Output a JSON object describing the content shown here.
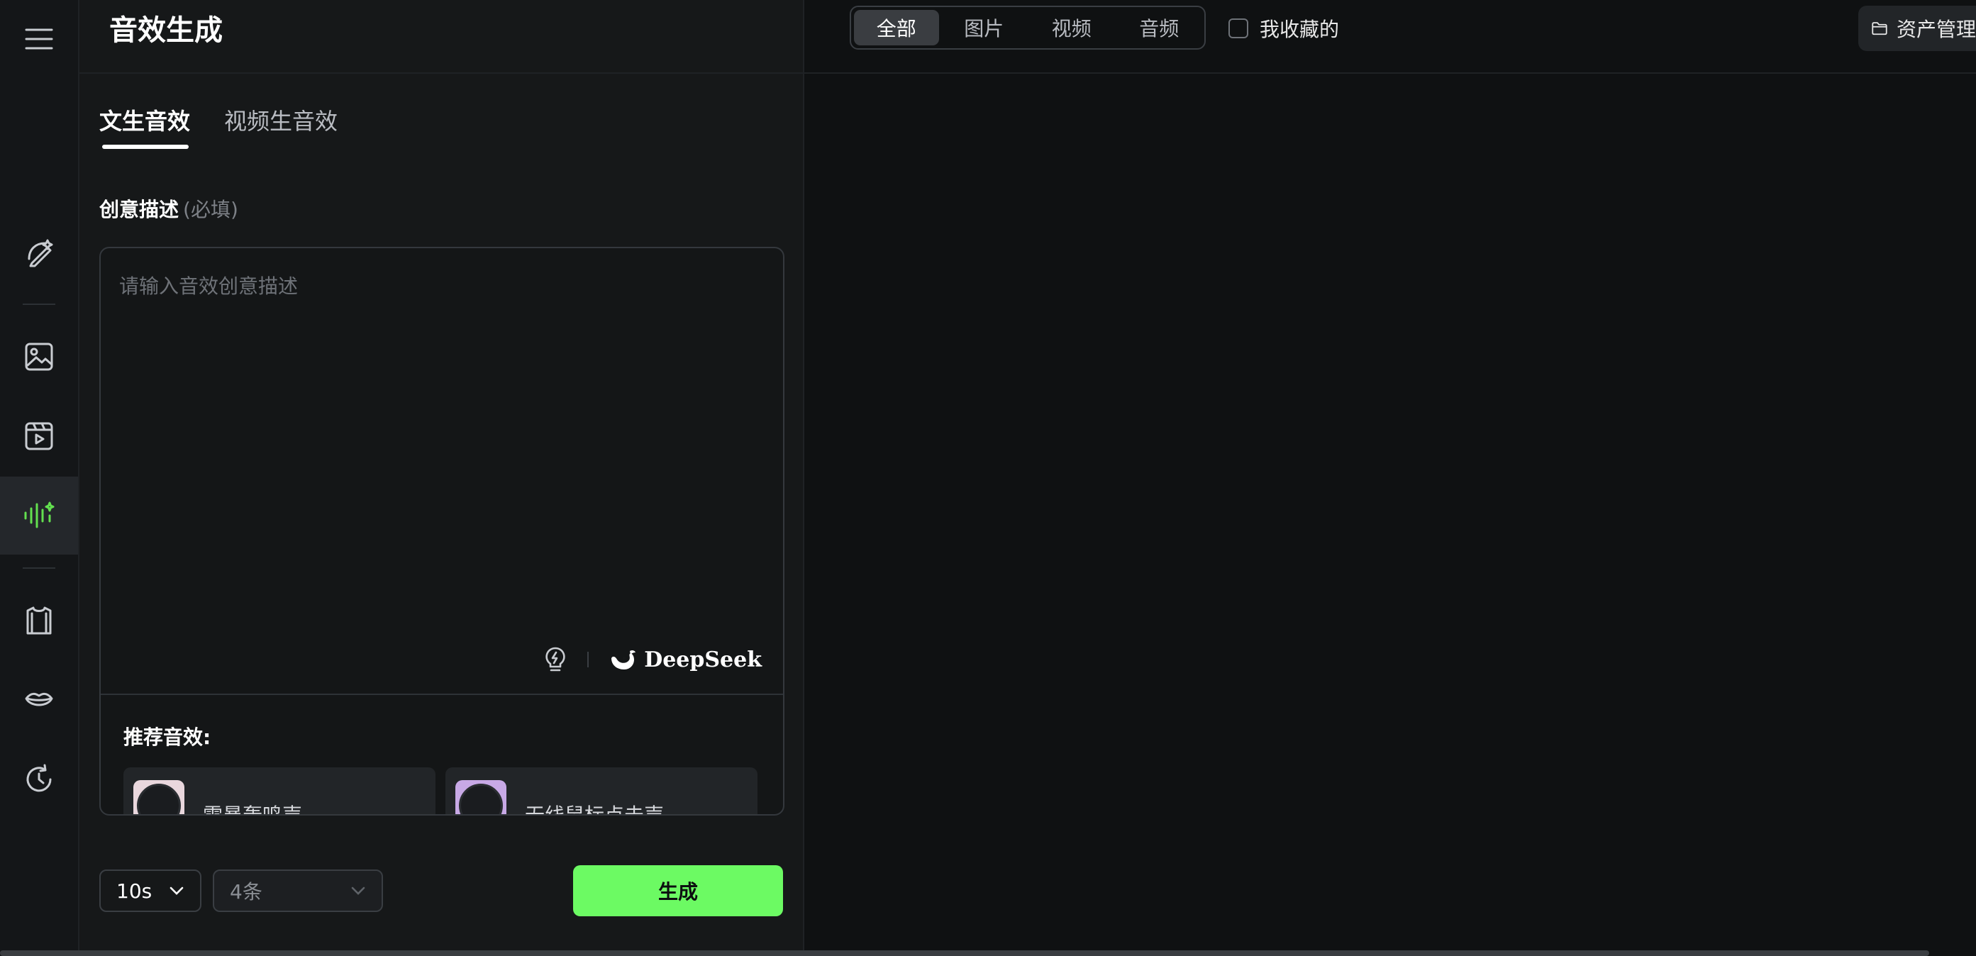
{
  "page_title": "音效生成",
  "tabs": [
    {
      "label": "文生音效",
      "active": true
    },
    {
      "label": "视频生音效",
      "active": false
    }
  ],
  "prompt": {
    "label": "创意描述",
    "required_hint": "(必填)",
    "placeholder": "请输入音效创意描述",
    "value": ""
  },
  "tools": {
    "inspire_icon": "lightbulb-bolt-icon",
    "brand_name": "DeepSeek",
    "brand_icon": "whale-icon"
  },
  "recommended": {
    "label": "推荐音效:",
    "items": [
      {
        "name": "雷暴轰鸣声",
        "thumb_color": "#e9d7dd"
      },
      {
        "name": "无线鼠标点击声",
        "thumb_color": "#c8a9e6"
      }
    ]
  },
  "controls": {
    "duration": "10s",
    "count": "4条",
    "generate_label": "生成"
  },
  "filter": {
    "segments": [
      {
        "label": "全部",
        "active": true
      },
      {
        "label": "图片",
        "active": false
      },
      {
        "label": "视频",
        "active": false
      },
      {
        "label": "音频",
        "active": false
      }
    ],
    "favorites_label": "我收藏的",
    "favorites_checked": false
  },
  "assets_label": "资产管理",
  "rail": [
    {
      "icon": "menu-icon"
    },
    {
      "icon": "magic-pen-icon"
    },
    {
      "icon": "image-icon"
    },
    {
      "icon": "video-icon"
    },
    {
      "icon": "audio-wave-icon",
      "active": true
    },
    {
      "icon": "shirt-icon"
    },
    {
      "icon": "lips-icon"
    },
    {
      "icon": "history-icon"
    }
  ],
  "colors": {
    "accent": "#6cfa63",
    "active_icon": "#63e04f",
    "background": "#0f1112"
  }
}
